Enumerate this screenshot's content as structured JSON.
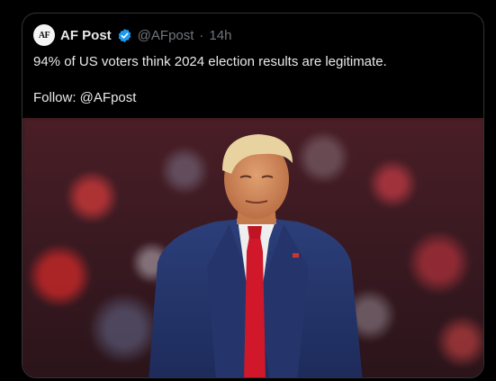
{
  "tweet": {
    "author_name": "AF Post",
    "avatar_text": "AF",
    "handle": "@AFpost",
    "separator": "·",
    "timestamp": "14h",
    "text_line1": "94% of US voters think 2024 election results are legitimate.",
    "text_line2": "Follow: @AFpost"
  },
  "icons": {
    "verified": "verified-badge-icon"
  },
  "colors": {
    "background": "#000000",
    "text_primary": "#e7e9ea",
    "text_secondary": "#71767b",
    "border": "#2f3336",
    "verified": "#1d9bf0"
  }
}
